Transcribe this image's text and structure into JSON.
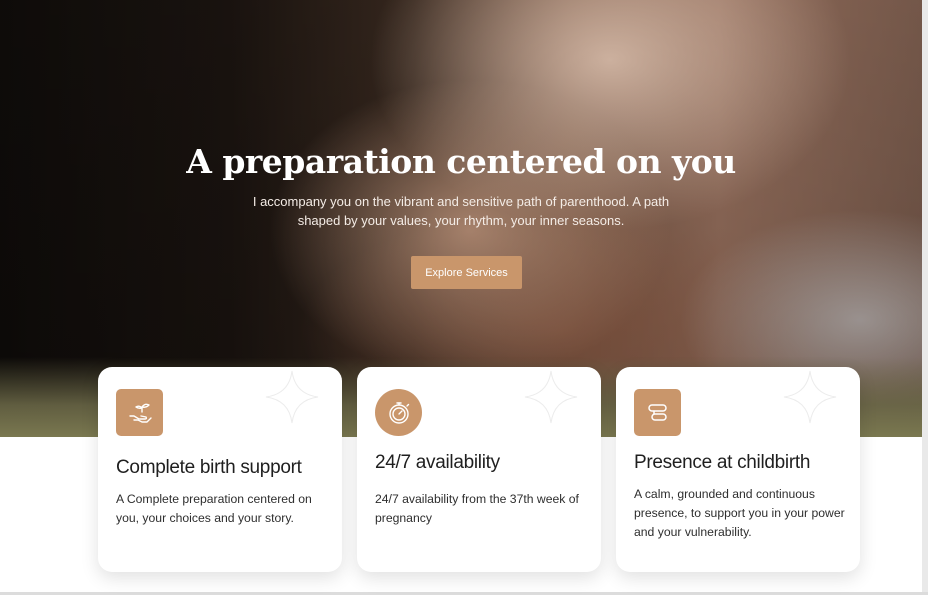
{
  "hero": {
    "title": "A preparation centered on you",
    "subtitle": "I accompany you on the vibrant and sensitive path of parenthood. A path shaped by your values, your rhythm, your inner seasons.",
    "button_label": "Explore Services"
  },
  "colors": {
    "accent": "#c9966b",
    "card_bg": "#ffffff",
    "title_text": "#1f1f1f"
  },
  "cards": [
    {
      "icon": "hand-with-seedling-icon",
      "title": "Complete birth support",
      "description": "A Complete preparation centered on you, your choices and your story."
    },
    {
      "icon": "stopwatch-icon",
      "title": "24/7 availability",
      "description": "24/7 availability from the 37th week of pregnancy"
    },
    {
      "icon": "signpost-icon",
      "title": "Presence at childbirth",
      "description": "A calm, grounded and continuous presence, to support you in your power and your vulnerability."
    }
  ]
}
